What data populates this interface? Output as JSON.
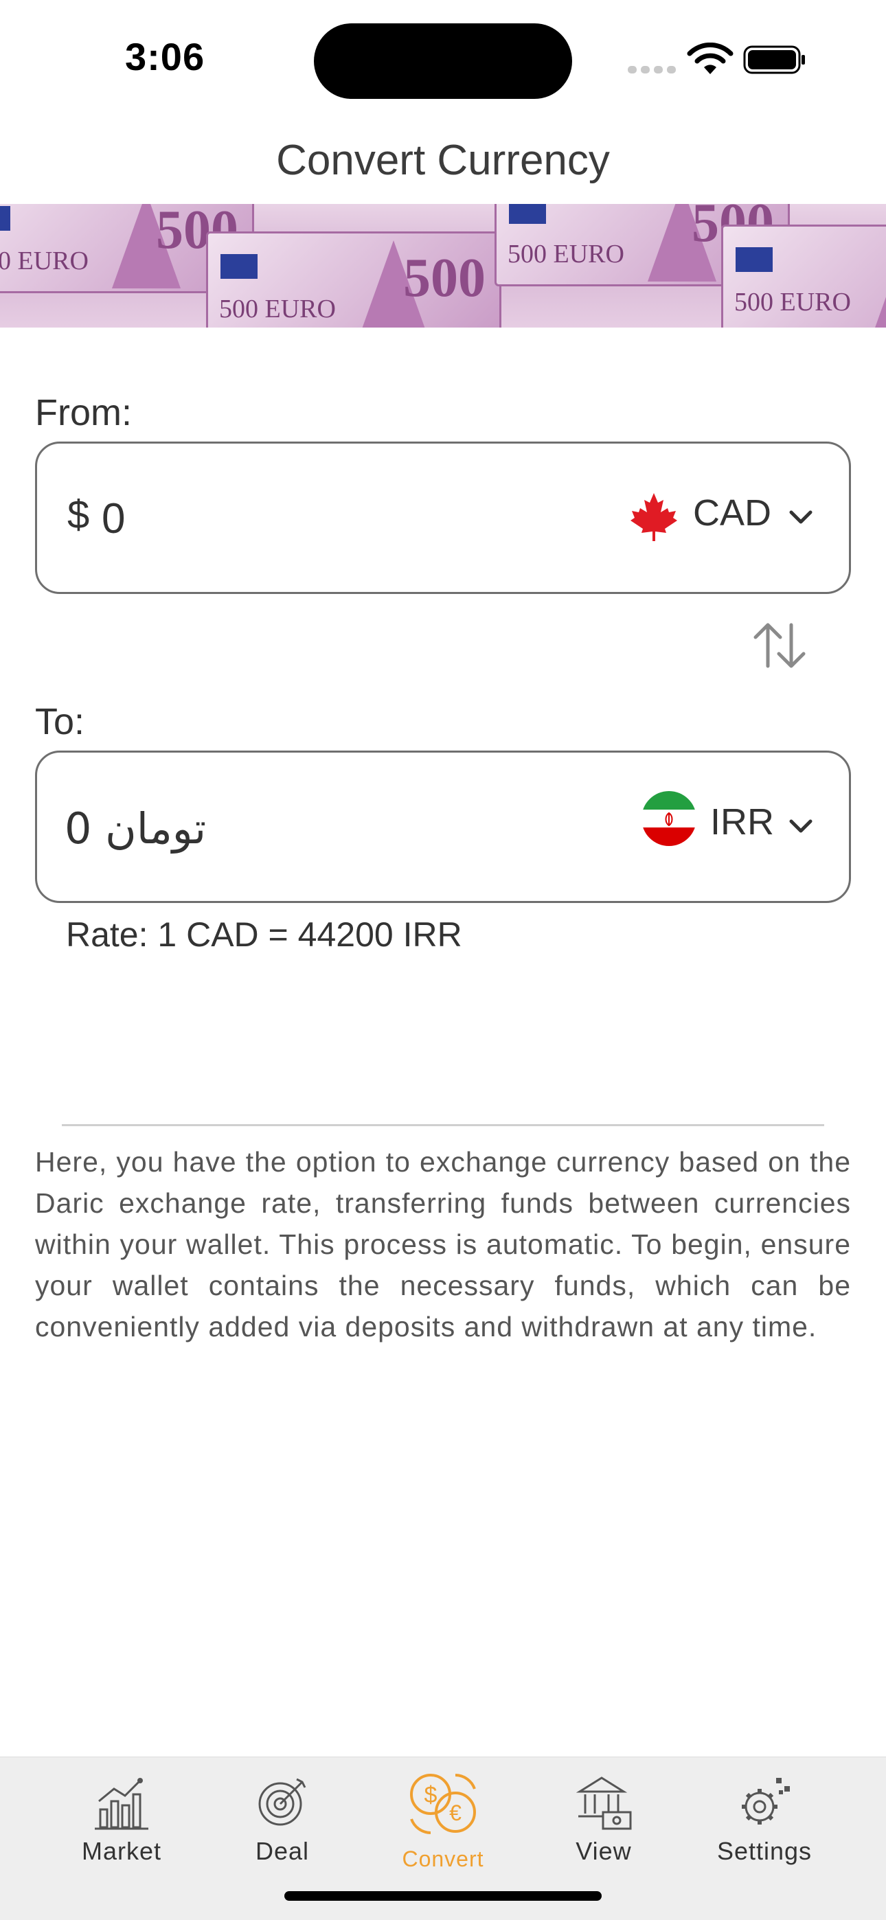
{
  "status_bar": {
    "time": "3:06"
  },
  "header": {
    "title": "Convert Currency"
  },
  "banner": {
    "note_value": "500",
    "note_text": "500 EURO"
  },
  "from": {
    "label": "From:",
    "symbol": "$",
    "amount": "0",
    "currency_code": "CAD",
    "flag": "canada-flag-icon"
  },
  "to": {
    "label": "To:",
    "amount": "0 تومان",
    "currency_code": "IRR",
    "flag": "iran-flag-icon"
  },
  "rate": {
    "text": "Rate: 1 CAD = 44200 IRR"
  },
  "description": "Here, you have the option to exchange currency based on the Daric exchange rate, transferring funds between currencies within your wallet. This process is automatic. To begin, ensure your wallet contains the necessary funds, which can be conveniently added via deposits and withdrawn at any time.",
  "tabs": [
    {
      "label": "Market",
      "icon": "chart-icon",
      "active": false
    },
    {
      "label": "Deal",
      "icon": "target-icon",
      "active": false
    },
    {
      "label": "Convert",
      "icon": "currency-exchange-icon",
      "active": true
    },
    {
      "label": "View",
      "icon": "bank-icon",
      "active": false
    },
    {
      "label": "Settings",
      "icon": "gear-icon",
      "active": false
    }
  ],
  "colors": {
    "accent": "#f0a030",
    "border": "#6f6f6f",
    "tabbar_bg": "#eeeeee"
  }
}
